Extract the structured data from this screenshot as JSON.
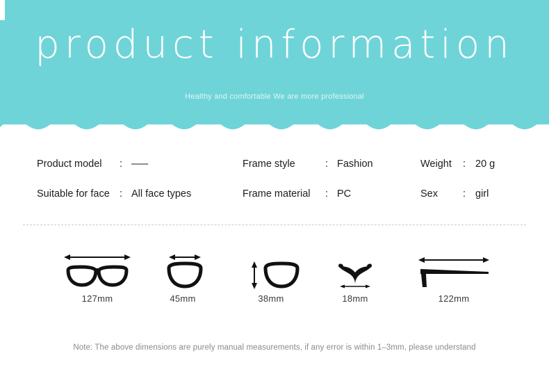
{
  "banner": {
    "title": "product information",
    "subtitle": "Healthy and comfortable We are more professional",
    "bg_color": "#6fd4d8",
    "title_color": "#ffffff"
  },
  "specs": {
    "columns": [
      {
        "rows": [
          {
            "label": "Product model",
            "colon": ":",
            "value": "–––"
          },
          {
            "label": "Suitable for face",
            "colon": ":",
            "value": "All face types"
          }
        ]
      },
      {
        "rows": [
          {
            "label": "Frame style",
            "colon": ":",
            "value": "Fashion"
          },
          {
            "label": "Frame material",
            "colon": ":",
            "value": "PC"
          }
        ]
      },
      {
        "rows": [
          {
            "label": "Weight",
            "colon": ":",
            "value": "20 g"
          },
          {
            "label": "Sex",
            "colon": ":",
            "value": "girl"
          }
        ]
      }
    ]
  },
  "dimensions": {
    "items": [
      {
        "icon": "glasses-front-icon",
        "label": "127mm",
        "measure": "total frame width"
      },
      {
        "icon": "lens-width-icon",
        "label": "45mm",
        "measure": "lens width"
      },
      {
        "icon": "lens-height-icon",
        "label": "38mm",
        "measure": "lens height"
      },
      {
        "icon": "bridge-icon",
        "label": "18mm",
        "measure": "bridge width"
      },
      {
        "icon": "temple-arm-icon",
        "label": "122mm",
        "measure": "temple length"
      }
    ]
  },
  "note": {
    "text": "Note: The above dimensions are purely manual measurements, if any error is within 1–3mm, please understand"
  }
}
